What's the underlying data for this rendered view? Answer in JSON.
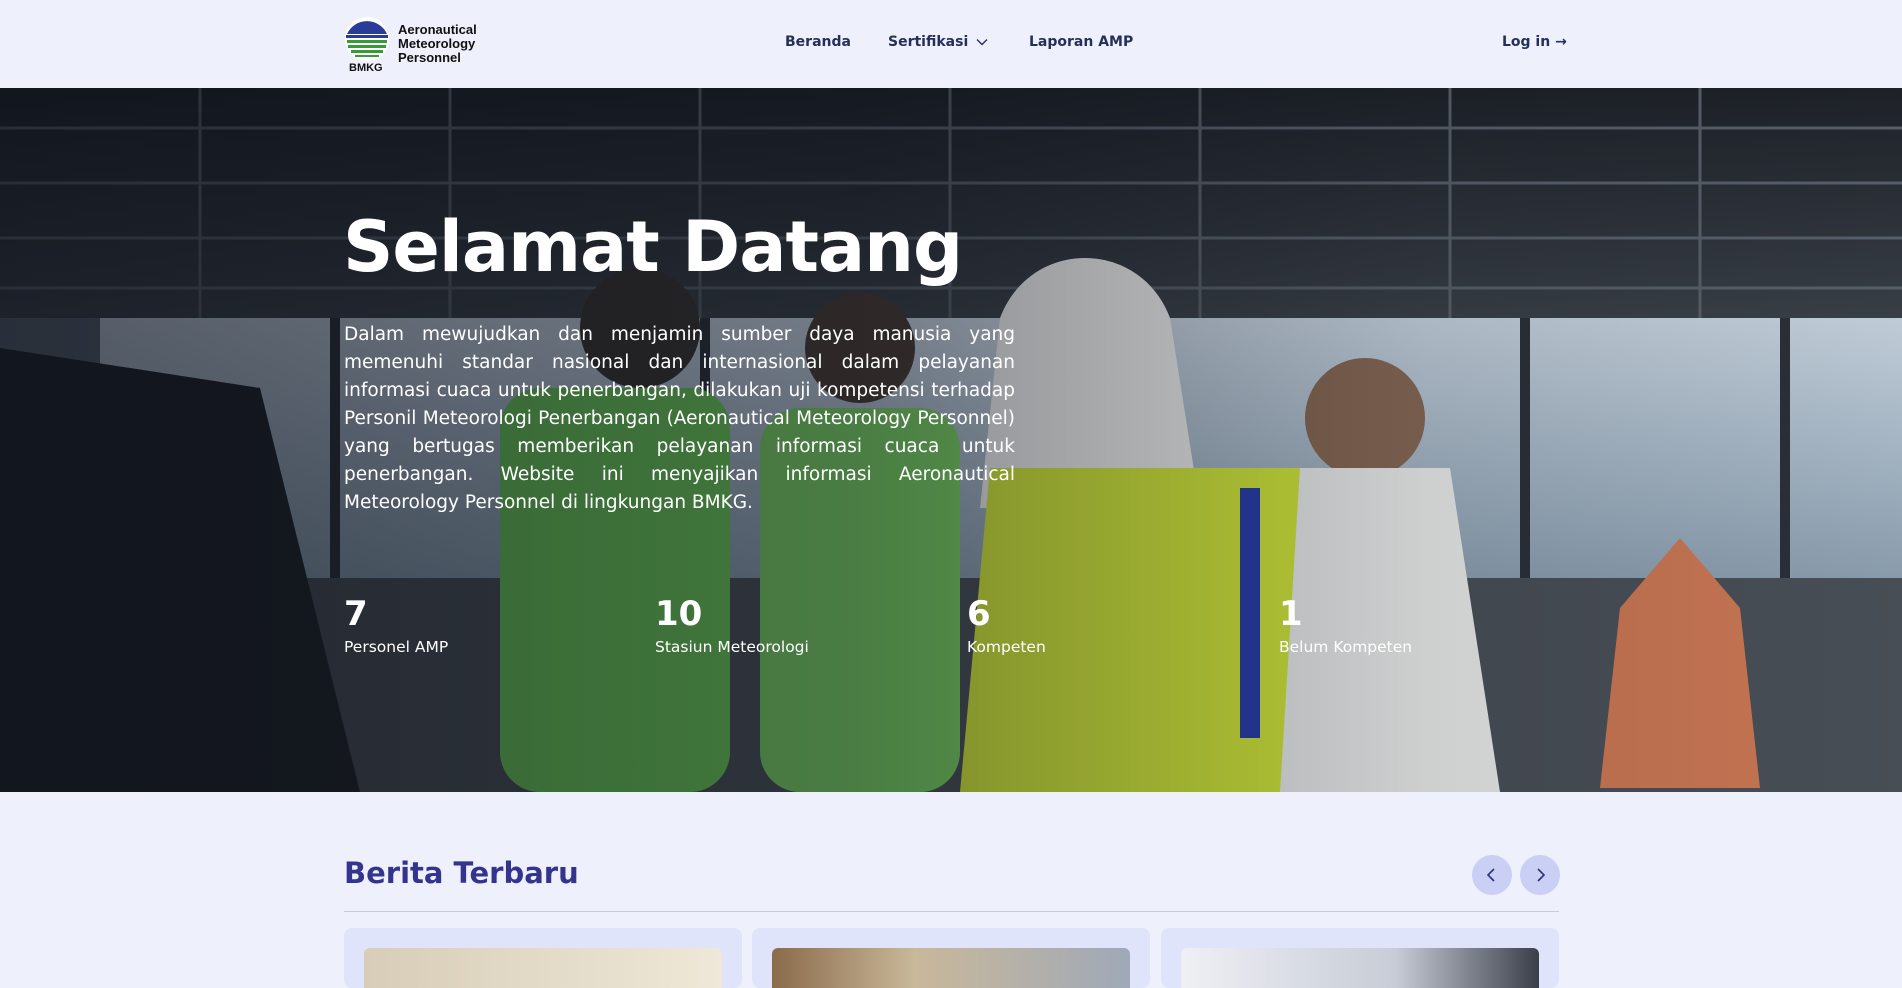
{
  "navbar": {
    "logo_lines": [
      "Aeronautical",
      "Meteorology",
      "Personnel"
    ],
    "logo_badge": "BMKG",
    "menu": {
      "beranda": "Beranda",
      "sertifikasi": "Sertifikasi",
      "laporan": "Laporan AMP"
    },
    "login": "Log in →"
  },
  "hero": {
    "title": "Selamat Datang",
    "description": "Dalam mewujudkan dan menjamin sumber daya manusia yang memenuhi standar nasional dan internasional dalam pelayanan informasi cuaca untuk penerbangan, dilakukan uji kompetensi terhadap Personil Meteorologi Penerbangan (Aeronautical Meteorology Personnel) yang bertugas memberikan pelayanan informasi cuaca untuk penerbangan. Website ini menyajikan informasi Aeronautical Meteorology Personnel di lingkungan BMKG.",
    "stats": [
      {
        "value": "7",
        "label": "Personel AMP"
      },
      {
        "value": "10",
        "label": "Stasiun Meteorologi"
      },
      {
        "value": "6",
        "label": "Kompeten"
      },
      {
        "value": "1",
        "label": "Belum Kompeten"
      }
    ]
  },
  "news": {
    "title": "Berita Terbaru"
  },
  "colors": {
    "page_background": "#eef1fc",
    "nav_text": "#25305a",
    "news_title": "#34348f",
    "arrow_button": "#c9cff5"
  },
  "icons": [
    "bmkg-logo-icon",
    "chevron-down-icon",
    "arrow-left-icon",
    "arrow-right-icon"
  ]
}
